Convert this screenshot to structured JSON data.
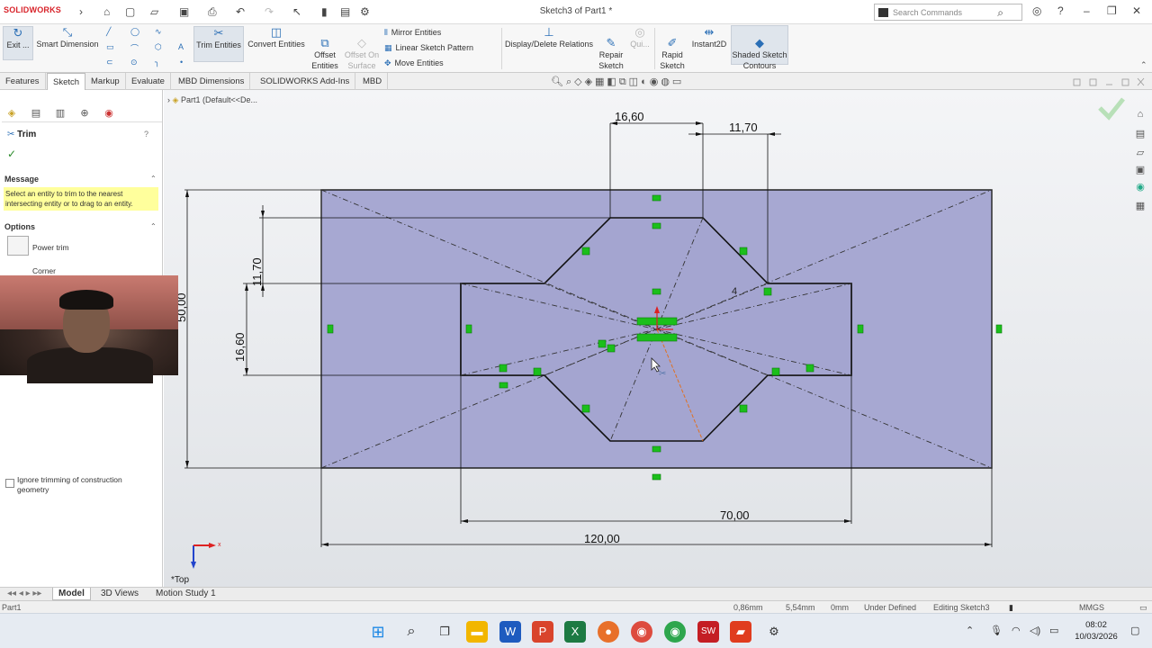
{
  "app": {
    "logo": "SOLIDWORKS",
    "title": "Sketch3 of Part1 *",
    "search_placeholder": "Search Commands"
  },
  "quick_access": {
    "icons": [
      "home-icon",
      "new-icon",
      "open-icon",
      "save-icon",
      "print-icon",
      "undo-icon",
      "redo-icon",
      "select-icon",
      "rebuild-icon",
      "file-properties-icon",
      "options-icon"
    ]
  },
  "ribbon": {
    "exit": "Exit ...",
    "smart_dimension": "Smart Dimension",
    "trim_entities": "Trim Entities",
    "convert_entities": "Convert Entities",
    "offset_entities": "Offset\nEntities",
    "offset_on_surface": "Offset On\nSurface",
    "mirror_entities": "Mirror Entities",
    "linear_sketch_pattern": "Linear Sketch Pattern",
    "move_entities": "Move Entities",
    "display_delete_relations": "Display/Delete Relations",
    "repair_sketch": "Repair\nSketch",
    "quick_snaps": "Qui...",
    "rapid_sketch": "Rapid\nSketch",
    "instant2d": "Instant2D",
    "shaded_sketch_contours": "Shaded Sketch\nContours"
  },
  "tabs": [
    "Features",
    "Sketch",
    "Markup",
    "Evaluate",
    "MBD Dimensions",
    "SOLIDWORKS Add-Ins",
    "MBD"
  ],
  "active_tab": "Sketch",
  "tree": {
    "part": "Part1  (Default<<De..."
  },
  "property_manager": {
    "title": "Trim",
    "message_header": "Message",
    "message": "Select an entity to trim to the nearest intersecting entity or to drag to an entity.",
    "options_header": "Options",
    "options": [
      "Power trim",
      "Corner"
    ],
    "ignore_construction": "Ignore trimming of construction geometry"
  },
  "dimensions": {
    "d1": "16,60",
    "d2": "11,70",
    "d3": "11,70",
    "d4": "16,60",
    "d5": "50,00",
    "d6": "70,00",
    "d7": "120,00",
    "d8": "4"
  },
  "view": {
    "orientation": "*Top"
  },
  "bottom_tabs": [
    "Model",
    "3D Views",
    "Motion Study 1"
  ],
  "active_bottom_tab": "Model",
  "status": {
    "part": "Part1",
    "x": "0,86mm",
    "y": "5,54mm",
    "z": "0mm",
    "state": "Under Defined",
    "editing": "Editing Sketch3",
    "units": "MMGS"
  },
  "colors": {
    "sketch_fill": "#a7a8d2",
    "relation_green": "#1bbf1b",
    "accent": "#2b6fb6"
  },
  "clock": {
    "time": "08:02",
    "date": "10/03/2026"
  }
}
